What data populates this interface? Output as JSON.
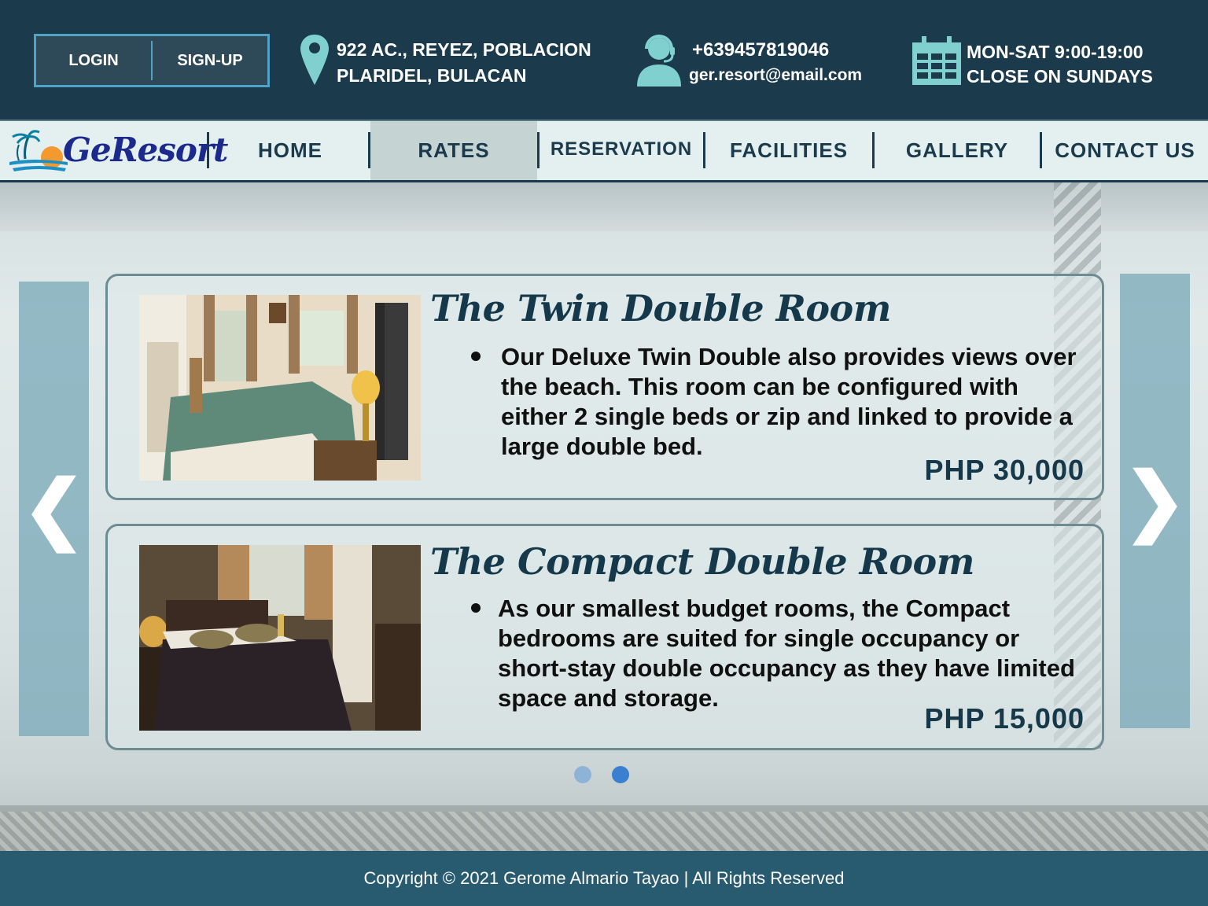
{
  "auth": {
    "login_label": "LOGIN",
    "signup_label": "SIGN-UP"
  },
  "contact": {
    "address_line1": "922 AC., REYEZ, POBLACION",
    "address_line2": "PLARIDEL, BULACAN",
    "phone": "+639457819046",
    "email": "ger.resort@email.com",
    "hours_line1": "MON-SAT 9:00-19:00",
    "hours_line2": "CLOSE ON SUNDAYS"
  },
  "brand": {
    "name": "GeResort",
    "accent": "#1b3a4b",
    "highlight": "#4fa3c7"
  },
  "nav": {
    "items": [
      {
        "label": "HOME"
      },
      {
        "label": "RATES"
      },
      {
        "label": "RESERVATION"
      },
      {
        "label": "FACILITIES"
      },
      {
        "label": "GALLERY"
      },
      {
        "label": "CONTACT US"
      }
    ],
    "active": "RATES"
  },
  "slider": {
    "prev_icon": "chevron-left-icon",
    "next_icon": "chevron-right-icon",
    "prev_glyph": "❮",
    "next_glyph": "❯",
    "pages": 2,
    "current_page": 2
  },
  "rooms": [
    {
      "title": "The Twin Double Room",
      "description": "Our Deluxe Twin Double also provides views over the beach. This room can be configured with either 2 single beds or zip and linked to provide a large double bed.",
      "price": "PHP 30,000"
    },
    {
      "title": "The Compact Double Room",
      "description": "As our smallest budget rooms, the Compact bedrooms are suited for single occupancy or short-stay double occupancy as they have limited space and storage.",
      "price": "PHP 15,000"
    }
  ],
  "footer": {
    "copyright": "Copyright © 2021 Gerome Almario Tayao | All Rights Reserved"
  }
}
